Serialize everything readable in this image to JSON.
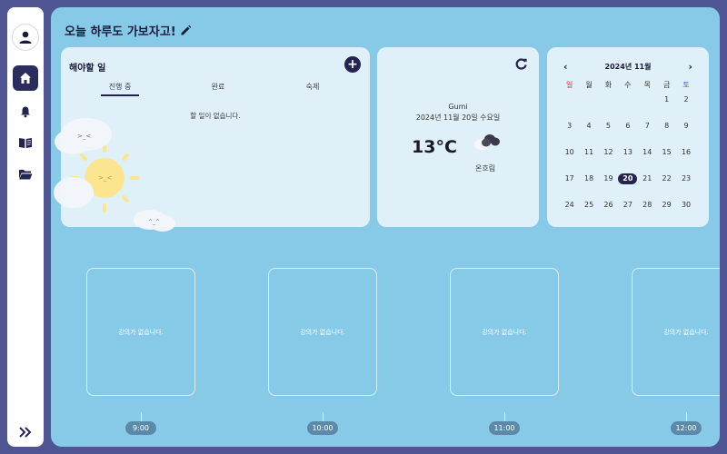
{
  "header": {
    "title": "오늘 하루도 가보자고!"
  },
  "sidebar": {
    "items": [
      {
        "name": "home",
        "icon": "home-icon",
        "active": true
      },
      {
        "name": "notifications",
        "icon": "bell-icon"
      },
      {
        "name": "lectures",
        "icon": "book-icon"
      },
      {
        "name": "files",
        "icon": "folder-icon"
      }
    ],
    "expand_icon": "double-chevron-right-icon"
  },
  "todo": {
    "title": "해야할 일",
    "tabs": [
      "진행 중",
      "완료",
      "숙제"
    ],
    "active_tab": "진행 중",
    "empty_text": "할 일이 없습니다."
  },
  "weather": {
    "city": "Gumi",
    "date": "2024년 11월 20일 수요일",
    "temperature": "13°C",
    "condition": "온흐림"
  },
  "calendar": {
    "title": "2024년 11월",
    "weekdays": [
      "일",
      "월",
      "화",
      "수",
      "목",
      "금",
      "토"
    ],
    "weeks": [
      [
        "",
        "",
        "",
        "",
        "",
        "1",
        "2"
      ],
      [
        "3",
        "4",
        "5",
        "6",
        "7",
        "8",
        "9"
      ],
      [
        "10",
        "11",
        "12",
        "13",
        "14",
        "15",
        "16"
      ],
      [
        "17",
        "18",
        "19",
        "20",
        "21",
        "22",
        "23"
      ],
      [
        "24",
        "25",
        "26",
        "27",
        "28",
        "29",
        "30"
      ]
    ],
    "today": "20"
  },
  "timeline": {
    "slots": [
      {
        "time": "9:00",
        "text": "강의가 없습니다."
      },
      {
        "time": "10:00",
        "text": "강의가 없습니다."
      },
      {
        "time": "11:00",
        "text": "강의가 없습니다."
      },
      {
        "time": "12:00",
        "text": "강의가 없습니다."
      }
    ]
  },
  "colors": {
    "accent": "#232550",
    "background": "#86cae8",
    "frame": "#4f5592",
    "sunday": "#dd3333",
    "saturday": "#3358c9"
  }
}
